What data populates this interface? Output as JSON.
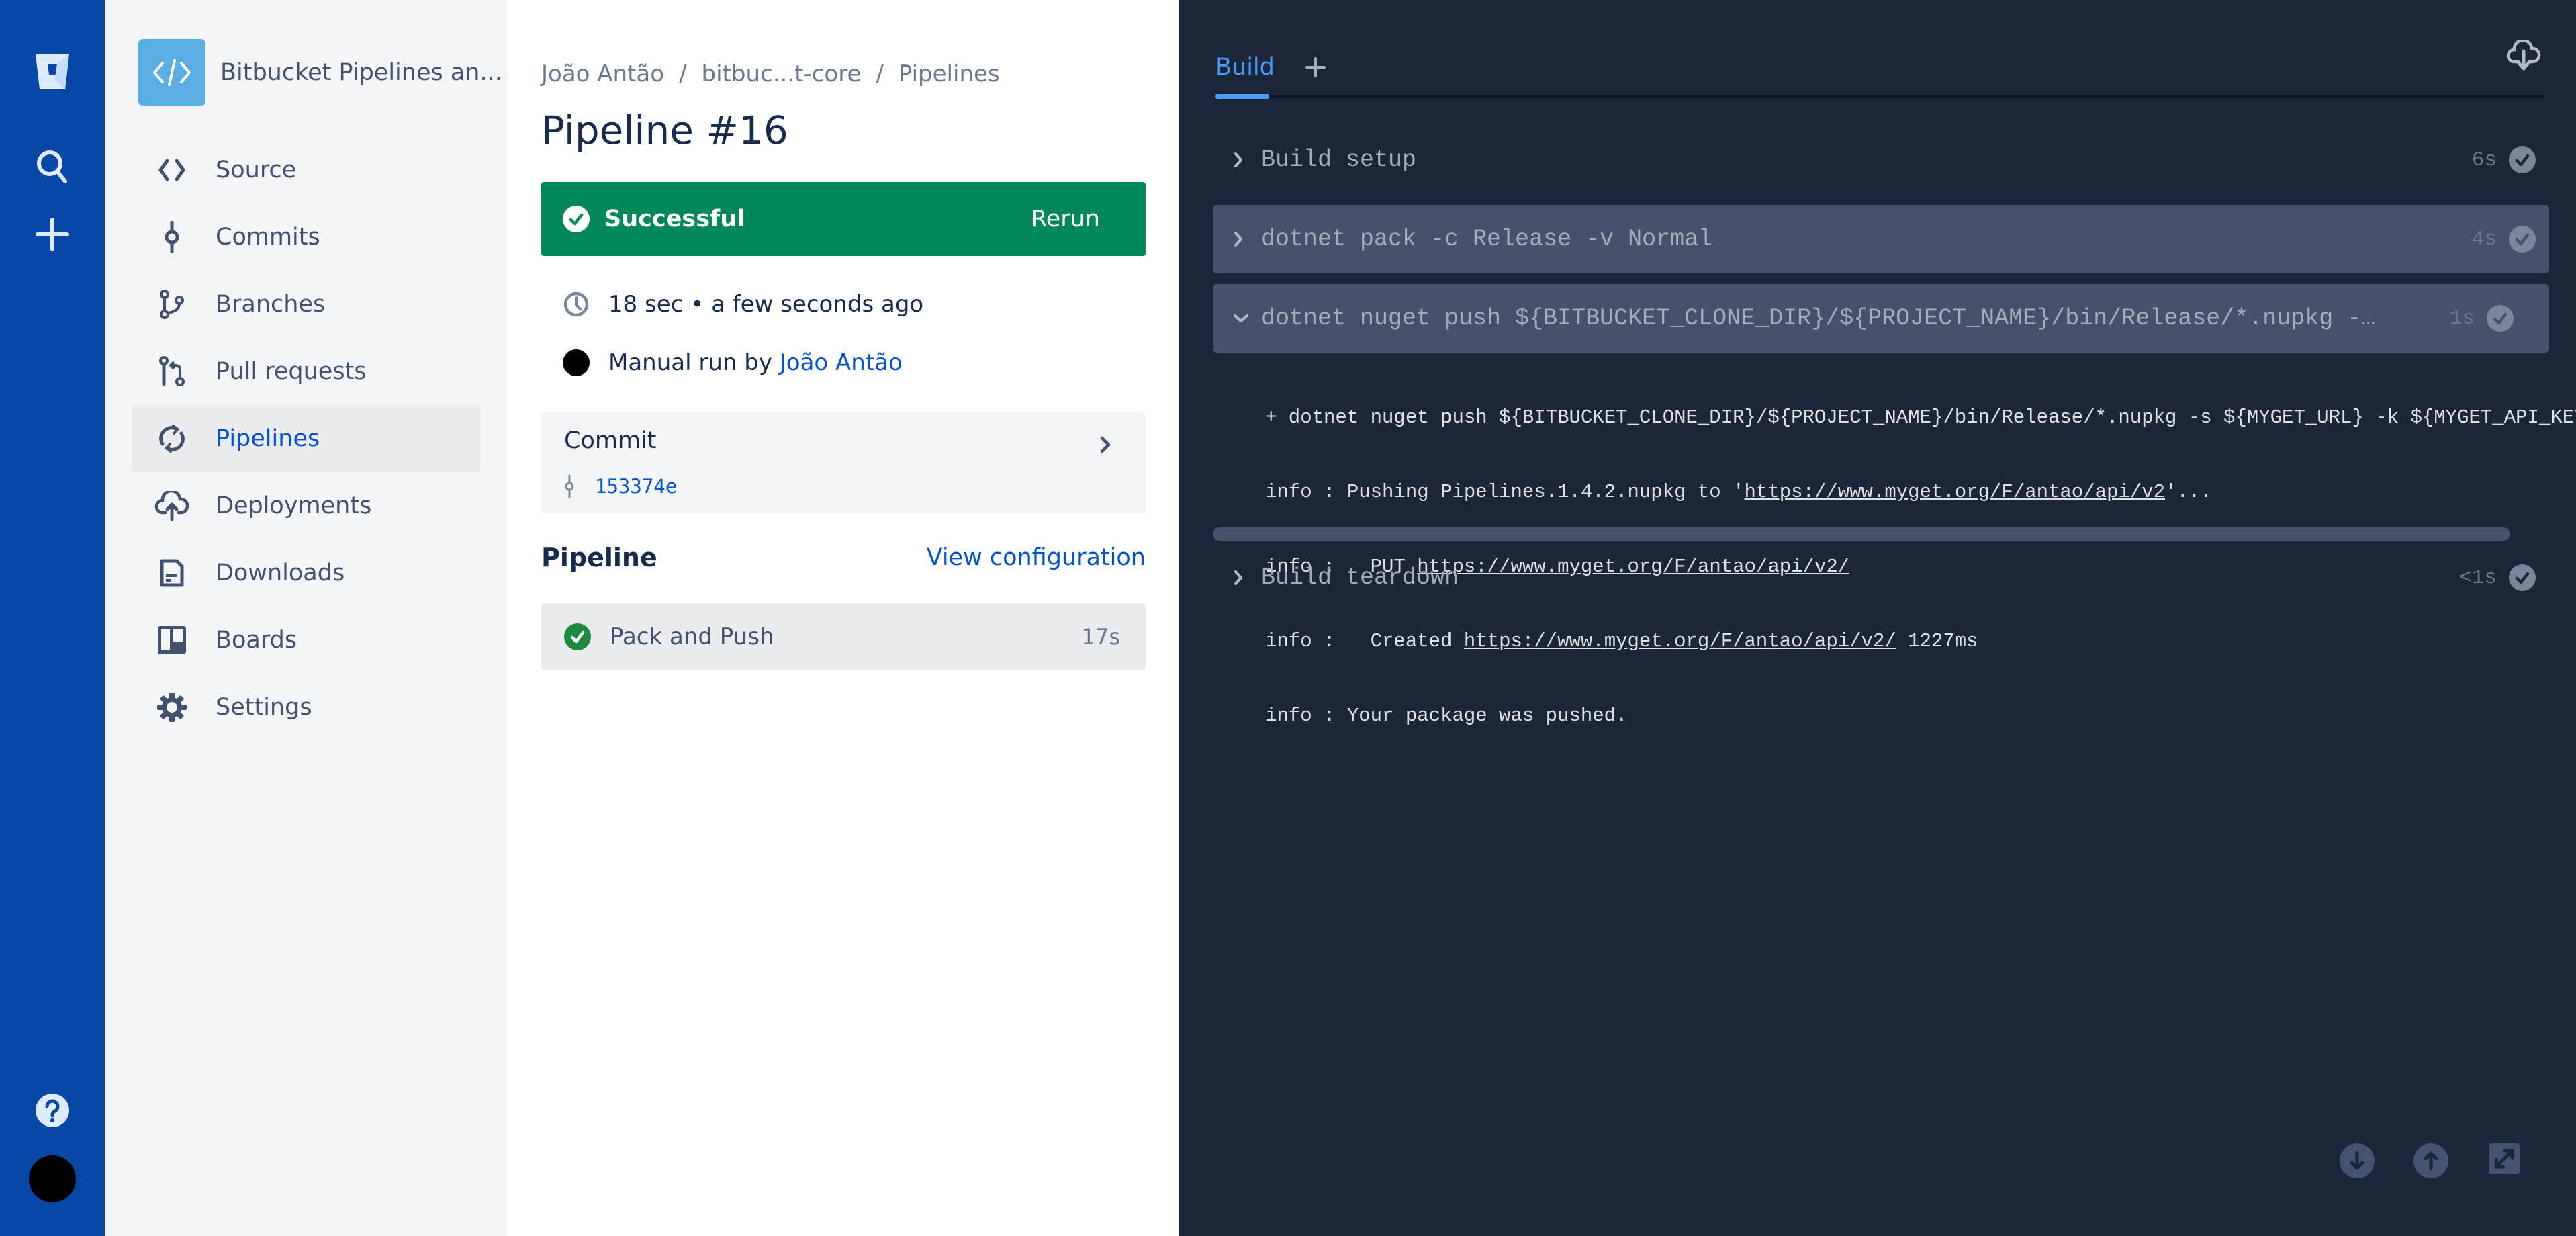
{
  "rail": {
    "icons": [
      "bitbucket-logo",
      "search-icon",
      "create-icon",
      "help-icon",
      "user-avatar"
    ]
  },
  "sidebar": {
    "project_name": "Bitbucket Pipelines an...",
    "items": [
      {
        "label": "Source",
        "icon": "source-icon"
      },
      {
        "label": "Commits",
        "icon": "commit-icon"
      },
      {
        "label": "Branches",
        "icon": "branch-icon"
      },
      {
        "label": "Pull requests",
        "icon": "pull-request-icon"
      },
      {
        "label": "Pipelines",
        "icon": "pipelines-icon",
        "active": true
      },
      {
        "label": "Deployments",
        "icon": "deployments-icon"
      },
      {
        "label": "Downloads",
        "icon": "downloads-icon"
      },
      {
        "label": "Boards",
        "icon": "boards-icon"
      },
      {
        "label": "Settings",
        "icon": "settings-icon"
      }
    ]
  },
  "main": {
    "breadcrumb": [
      "João Antão",
      "bitbuc...t-core",
      "Pipelines"
    ],
    "breadcrumb_sep": "/",
    "title": "Pipeline #16",
    "status": {
      "label": "Successful",
      "action": "Rerun",
      "color": "#00875A"
    },
    "duration": "18 sec • a few seconds ago",
    "trigger_prefix": "Manual run by ",
    "trigger_user": "João Antão",
    "commit": {
      "heading": "Commit",
      "hash": "153374e"
    },
    "pipeline": {
      "heading": "Pipeline",
      "view_config": "View configuration",
      "steps": [
        {
          "name": "Pack and Push",
          "duration": "17s",
          "status": "success"
        }
      ]
    }
  },
  "terminal": {
    "tabs": [
      {
        "label": "Build",
        "active": true
      }
    ],
    "add_tab": "+",
    "steps": [
      {
        "name": "Build setup",
        "duration": "6s",
        "expanded": false
      },
      {
        "name": "dotnet pack -c Release -v Normal",
        "duration": "4s",
        "expanded": false
      },
      {
        "name": "dotnet nuget push ${BITBUCKET_CLONE_DIR}/${PROJECT_NAME}/bin/Release/*.nupkg -…",
        "duration": "1s",
        "expanded": true
      },
      {
        "name": "Build teardown",
        "duration": "<1s",
        "expanded": false
      }
    ],
    "log": {
      "line1": "+ dotnet nuget push ${BITBUCKET_CLONE_DIR}/${PROJECT_NAME}/bin/Release/*.nupkg -s ${MYGET_URL} -k ${MYGET_API_KEY}",
      "line2_prefix": "info : Pushing Pipelines.1.4.2.nupkg to '",
      "line2_link": "https://www.myget.org/F/antao/api/v2",
      "line2_suffix": "'...",
      "line3_prefix": "info :   PUT ",
      "line3_link": "https://www.myget.org/F/antao/api/v2/",
      "line4_prefix": "info :   Created ",
      "line4_link": "https://www.myget.org/F/antao/api/v2/",
      "line4_suffix": " 1227ms",
      "line5": "info : Your package was pushed."
    },
    "footer_buttons": [
      "scroll-down",
      "scroll-up",
      "expand"
    ]
  }
}
